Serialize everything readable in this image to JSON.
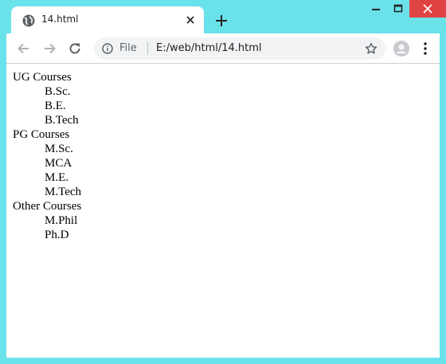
{
  "browser": {
    "tab_title": "14.html",
    "omnibox": {
      "scheme": "File",
      "url": "E:/web/html/14.html"
    }
  },
  "page": {
    "groups": [
      {
        "term": "UG Courses",
        "items": [
          "B.Sc.",
          "B.E.",
          "B.Tech"
        ]
      },
      {
        "term": "PG Courses",
        "items": [
          "M.Sc.",
          "MCA",
          "M.E.",
          "M.Tech"
        ]
      },
      {
        "term": "Other Courses",
        "items": [
          "M.Phil",
          "Ph.D"
        ]
      }
    ]
  },
  "icons": {
    "tab": "globe-icon",
    "tab_close": "close-icon",
    "new_tab": "plus-icon",
    "back": "back-arrow-icon",
    "forward": "forward-arrow-icon",
    "reload": "reload-icon",
    "info": "info-icon",
    "bookmark": "star-icon",
    "profile": "avatar-icon",
    "menu": "more-vertical-icon"
  },
  "colors": {
    "frame": "#6ae2ea",
    "close_button": "#e04343",
    "omnibox_bg": "#f1f3f4"
  }
}
